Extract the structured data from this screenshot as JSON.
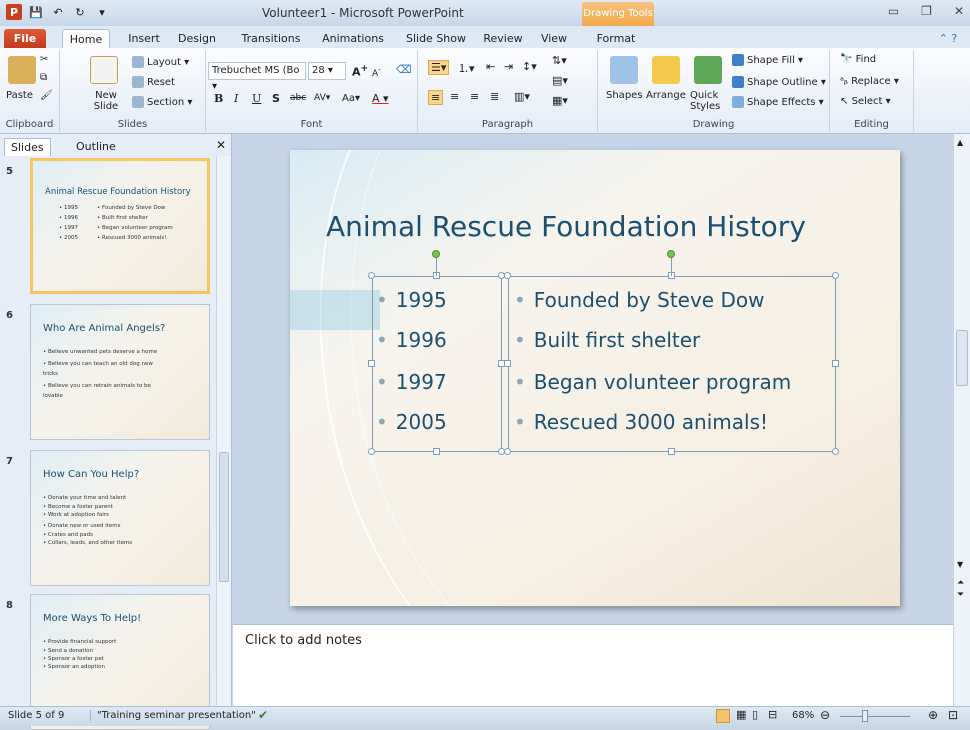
{
  "window": {
    "title": "Volunteer1 - Microsoft PowerPoint",
    "contextual_tab_group": "Drawing Tools"
  },
  "tabs": [
    "File",
    "Home",
    "Insert",
    "Design",
    "Transitions",
    "Animations",
    "Slide Show",
    "Review",
    "View",
    "Format"
  ],
  "active_tab": "Home",
  "ribbon": {
    "clipboard": {
      "paste": "Paste",
      "group": "Clipboard"
    },
    "slides": {
      "new_slide": "New Slide",
      "layout": "Layout",
      "reset": "Reset",
      "section": "Section",
      "group": "Slides"
    },
    "font": {
      "font_name": "Trebuchet MS (Bo",
      "font_size": "28",
      "group": "Font",
      "bold": "B",
      "italic": "I",
      "underline": "U",
      "shadow": "S",
      "strike": "abc",
      "spacing": "AV",
      "case": "Aa",
      "color": "A"
    },
    "paragraph": {
      "group": "Paragraph"
    },
    "drawing": {
      "shapes": "Shapes",
      "arrange": "Arrange",
      "quick_styles": "Quick Styles",
      "shape_fill": "Shape Fill",
      "shape_outline": "Shape Outline",
      "shape_effects": "Shape Effects",
      "group": "Drawing"
    },
    "editing": {
      "find": "Find",
      "replace": "Replace",
      "select": "Select",
      "group": "Editing"
    }
  },
  "panel": {
    "tabs": [
      "Slides",
      "Outline"
    ]
  },
  "thumbnails": [
    {
      "num": "5",
      "title": "Animal Rescue Foundation History",
      "lines": [
        "• 1995",
        "• 1996",
        "• 1997",
        "• 2005"
      ],
      "lines2": [
        "• Founded by Steve Dow",
        "• Built first shelter",
        "• Began volunteer program",
        "• Rescued 3000 animals!"
      ]
    },
    {
      "num": "6",
      "title": "Who Are Animal  Angels?",
      "lines": [
        "• Believe unwanted pets deserve a home",
        "• Believe you can teach an old dog new",
        "  tricks",
        "• Believe you can retrain animals to be",
        "  lovable"
      ]
    },
    {
      "num": "7",
      "title": "How Can You Help?",
      "lines": [
        "• Donate your time and talent",
        "   • Become a foster parent",
        "   • Work at adoption fairs",
        "• Donate new or used items",
        "   • Crates and pads",
        "   • Collars, leads, and other items"
      ]
    },
    {
      "num": "8",
      "title": "More Ways To Help!",
      "lines": [
        "• Provide financial support",
        "   • Send a donation",
        "   • Sponsor a foster pet",
        "   • Sponsor an adoption"
      ]
    }
  ],
  "slide": {
    "title": "Animal Rescue Foundation History",
    "years": [
      "1995",
      "1996",
      "1997",
      "2005"
    ],
    "events": [
      "Founded by Steve Dow",
      "Built first shelter",
      "Began volunteer program",
      "Rescued 3000 animals!"
    ]
  },
  "notes": {
    "placeholder": "Click to add notes"
  },
  "status": {
    "slide_of": "Slide 5 of 9",
    "theme": "\"Training seminar presentation\"",
    "zoom": "68%"
  },
  "colors": {
    "accent": "#c13b1d",
    "title_color": "#1d4f6e",
    "selection": "#f6c463"
  }
}
